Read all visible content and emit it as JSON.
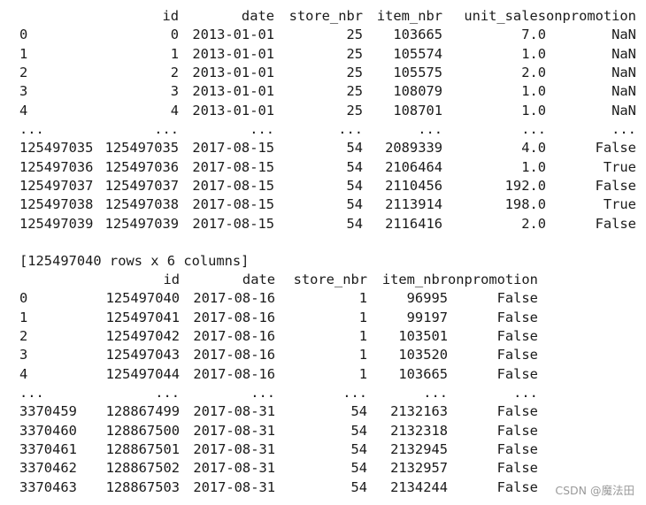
{
  "tables": [
    {
      "columns": [
        "",
        "id",
        "date",
        "store_nbr",
        "item_nbr",
        "unit_sales",
        "onpromotion"
      ],
      "rows": [
        [
          "0",
          "0",
          "2013-01-01",
          "25",
          "103665",
          "7.0",
          "NaN"
        ],
        [
          "1",
          "1",
          "2013-01-01",
          "25",
          "105574",
          "1.0",
          "NaN"
        ],
        [
          "2",
          "2",
          "2013-01-01",
          "25",
          "105575",
          "2.0",
          "NaN"
        ],
        [
          "3",
          "3",
          "2013-01-01",
          "25",
          "108079",
          "1.0",
          "NaN"
        ],
        [
          "4",
          "4",
          "2013-01-01",
          "25",
          "108701",
          "1.0",
          "NaN"
        ],
        [
          "...",
          "...",
          "...",
          "...",
          "...",
          "...",
          "..."
        ],
        [
          "125497035",
          "125497035",
          "2017-08-15",
          "54",
          "2089339",
          "4.0",
          "False"
        ],
        [
          "125497036",
          "125497036",
          "2017-08-15",
          "54",
          "2106464",
          "1.0",
          "True"
        ],
        [
          "125497037",
          "125497037",
          "2017-08-15",
          "54",
          "2110456",
          "192.0",
          "False"
        ],
        [
          "125497038",
          "125497038",
          "2017-08-15",
          "54",
          "2113914",
          "198.0",
          "True"
        ],
        [
          "125497039",
          "125497039",
          "2017-08-15",
          "54",
          "2116416",
          "2.0",
          "False"
        ]
      ],
      "summary": "[125497040 rows x 6 columns]"
    },
    {
      "columns": [
        "",
        "id",
        "date",
        "store_nbr",
        "item_nbr",
        "onpromotion"
      ],
      "rows": [
        [
          "0",
          "125497040",
          "2017-08-16",
          "1",
          "96995",
          "False"
        ],
        [
          "1",
          "125497041",
          "2017-08-16",
          "1",
          "99197",
          "False"
        ],
        [
          "2",
          "125497042",
          "2017-08-16",
          "1",
          "103501",
          "False"
        ],
        [
          "3",
          "125497043",
          "2017-08-16",
          "1",
          "103520",
          "False"
        ],
        [
          "4",
          "125497044",
          "2017-08-16",
          "1",
          "103665",
          "False"
        ],
        [
          "...",
          "...",
          "...",
          "...",
          "...",
          "..."
        ],
        [
          "3370459",
          "128867499",
          "2017-08-31",
          "54",
          "2132163",
          "False"
        ],
        [
          "3370460",
          "128867500",
          "2017-08-31",
          "54",
          "2132318",
          "False"
        ],
        [
          "3370461",
          "128867501",
          "2017-08-31",
          "54",
          "2132945",
          "False"
        ],
        [
          "3370462",
          "128867502",
          "2017-08-31",
          "54",
          "2132957",
          "False"
        ],
        [
          "3370463",
          "128867503",
          "2017-08-31",
          "54",
          "2134244",
          "False"
        ]
      ]
    }
  ],
  "watermark": "CSDN @魔法田"
}
